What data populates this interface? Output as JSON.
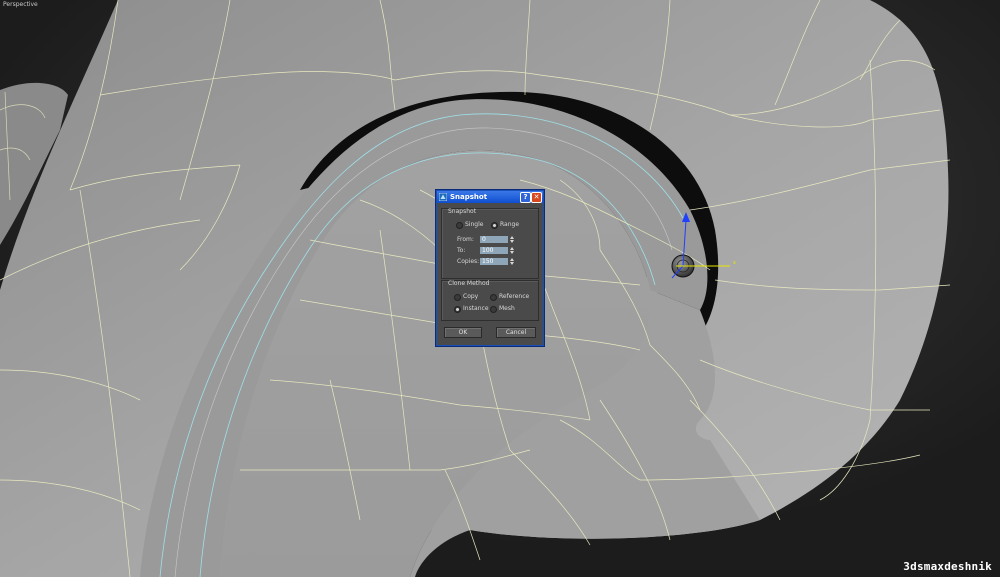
{
  "viewport": {
    "label": "Perspective"
  },
  "watermark": "3dsmaxdeshnik",
  "dialog": {
    "title": "Snapshot",
    "help_button": "?",
    "close_button": "✕",
    "snapshot_group": {
      "label": "Snapshot",
      "single_label": "Single",
      "range_label": "Range",
      "selected": "Range",
      "from_label": "From:",
      "from_value": "0",
      "to_label": "To:",
      "to_value": "100",
      "copies_label": "Copies:",
      "copies_value": "150"
    },
    "clone_group": {
      "label": "Clone Method",
      "copy_label": "Copy",
      "reference_label": "Reference",
      "instance_label": "Instance",
      "mesh_label": "Mesh",
      "selected": "Instance"
    },
    "ok_label": "OK",
    "cancel_label": "Cancel"
  },
  "gizmo": {
    "x_axis_label": "x",
    "x_color": "#e8e800",
    "y_color": "#2040ff",
    "z_color": "#2040ff"
  },
  "colors": {
    "wireframe": "#e8e8c0",
    "surface_light": "#a9a9a9",
    "surface_dark": "#111111",
    "dialog_border": "#1a4fb8",
    "inner_edge": "#9fe0e8"
  }
}
